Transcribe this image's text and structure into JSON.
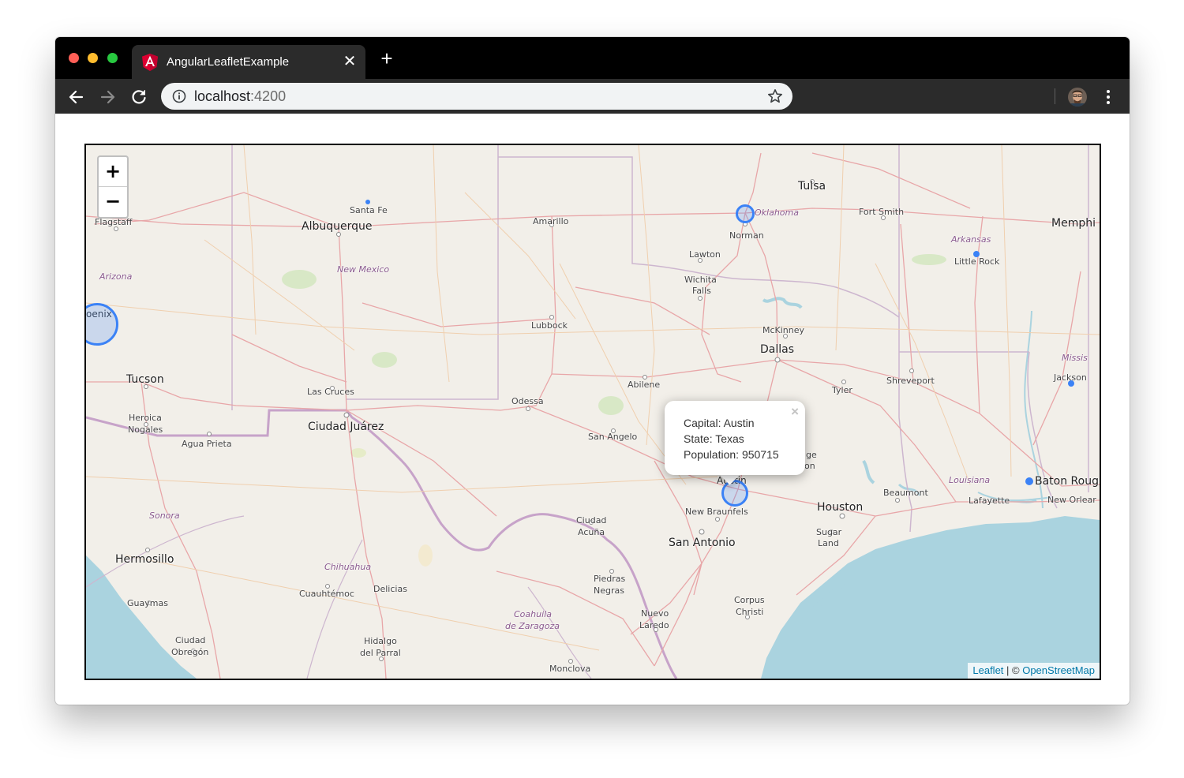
{
  "browser": {
    "tab_title": "AngularLeafletExample",
    "url_host": "localhost",
    "url_port": ":4200"
  },
  "map": {
    "zoom_in": "+",
    "zoom_out": "−",
    "labels": {
      "flagstaff": "Flagstaff",
      "santa_fe": "Santa Fe",
      "albuquerque": "Albuquerque",
      "amarillo": "Amarillo",
      "oklahoma": "Oklahoma",
      "tulsa": "Tulsa",
      "fort_smith": "Fort Smith",
      "memphis": "Memphi",
      "norman": "Norman",
      "arkansas": "Arkansas",
      "little_rock": "Little Rock",
      "lawton": "Lawton",
      "arizona": "Arizona",
      "new_mexico": "New Mexico",
      "wichita_falls_1": "Wichita",
      "wichita_falls_2": "Falls",
      "phoenix": "oenix",
      "lubbock": "Lubbock",
      "mckinney": "McKinney",
      "dallas": "Dallas",
      "mississippi": "Missis",
      "tucson": "Tucson",
      "jackson": "Jackson",
      "shreveport": "Shreveport",
      "abilene": "Abilene",
      "tyler": "Tyler",
      "las_cruces": "Las Cruces",
      "odessa": "Odessa",
      "heroica_nogales_1": "Heroica",
      "heroica_nogales_2": "Nogales",
      "ciudad_juarez": "Ciudad Juárez",
      "agua_prieta": "Agua Prieta",
      "san_angelo": "San Angelo",
      "college_station_1": "ge",
      "college_station_2": "on",
      "austin": "Austin",
      "louisiana": "Louisiana",
      "baton_rouge": "Baton Roug",
      "beaumont": "Beaumont",
      "lafayette": "Lafayette",
      "new_orleans": "New Orlear",
      "houston": "Houston",
      "sonora": "Sonora",
      "new_braunfels": "New Braunfels",
      "ciudad_acuna_1": "Ciudad",
      "ciudad_acuna_2": "Acuña",
      "sugar_land_1": "Sugar",
      "sugar_land_2": "Land",
      "san_antonio": "San Antonio",
      "hermosillo": "Hermosillo",
      "chihuahua": "Chihuahua",
      "cuauhtemoc": "Cuauhtémoc",
      "delicias": "Delicias",
      "piedras_negras_1": "Piedras",
      "piedras_negras_2": "Negras",
      "guaymas": "Guaymas",
      "corpus_christi_1": "Corpus",
      "corpus_christi_2": "Christi",
      "coahuila_1": "Coahuila",
      "coahuila_2": "de Zaragoza",
      "nuevo_laredo_1": "Nuevo",
      "nuevo_laredo_2": "Laredo",
      "ciudad_obregon_1": "Ciudad",
      "ciudad_obregon_2": "Obregón",
      "hidalgo_1": "Hidalgo",
      "hidalgo_2": "del Parral",
      "monclova": "Monclova"
    },
    "popup": {
      "close": "×",
      "capital": "Capital: Austin",
      "state": "State: Texas",
      "population": "Population: 950715"
    },
    "attribution": {
      "leaflet": "Leaflet",
      "separator": " | © ",
      "osm": "OpenStreetMap"
    }
  }
}
